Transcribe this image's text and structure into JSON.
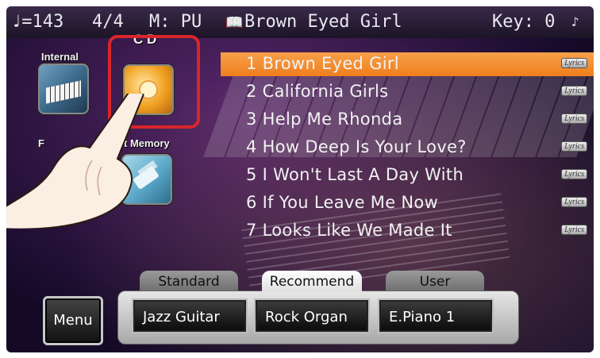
{
  "status": {
    "tempo": "♩=143",
    "time_signature": "4/4",
    "mode": "M: PU",
    "song_icon": "book-icon",
    "song": "Brown Eyed Girl",
    "key": "Key: 0",
    "tuning_icon": "tuning-fork-icon"
  },
  "sources": {
    "internal": "Internal",
    "cd": "C D",
    "usb_left": "F",
    "usb_right": "t Memory"
  },
  "songs": [
    {
      "title": "1 Brown Eyed Girl",
      "lyrics": "Lyrics",
      "selected": true
    },
    {
      "title": "2 California Girls",
      "lyrics": "Lyrics"
    },
    {
      "title": "3 Help Me Rhonda",
      "lyrics": "Lyrics"
    },
    {
      "title": "4 How Deep Is Your Love?",
      "lyrics": "Lyrics"
    },
    {
      "title": "5 I Won't Last A Day With",
      "lyrics": "Lyrics"
    },
    {
      "title": "6 If You Leave Me Now",
      "lyrics": "Lyrics"
    },
    {
      "title": "7 Looks Like We Made It",
      "lyrics": "Lyrics"
    }
  ],
  "menu": "Menu",
  "tabs": [
    "Standard",
    "Recommend",
    "User"
  ],
  "presets": [
    "Jazz Guitar",
    "Rock Organ",
    "E.Piano 1"
  ],
  "colors": {
    "selection": "#ef7e1e",
    "highlight": "#d8262a"
  }
}
